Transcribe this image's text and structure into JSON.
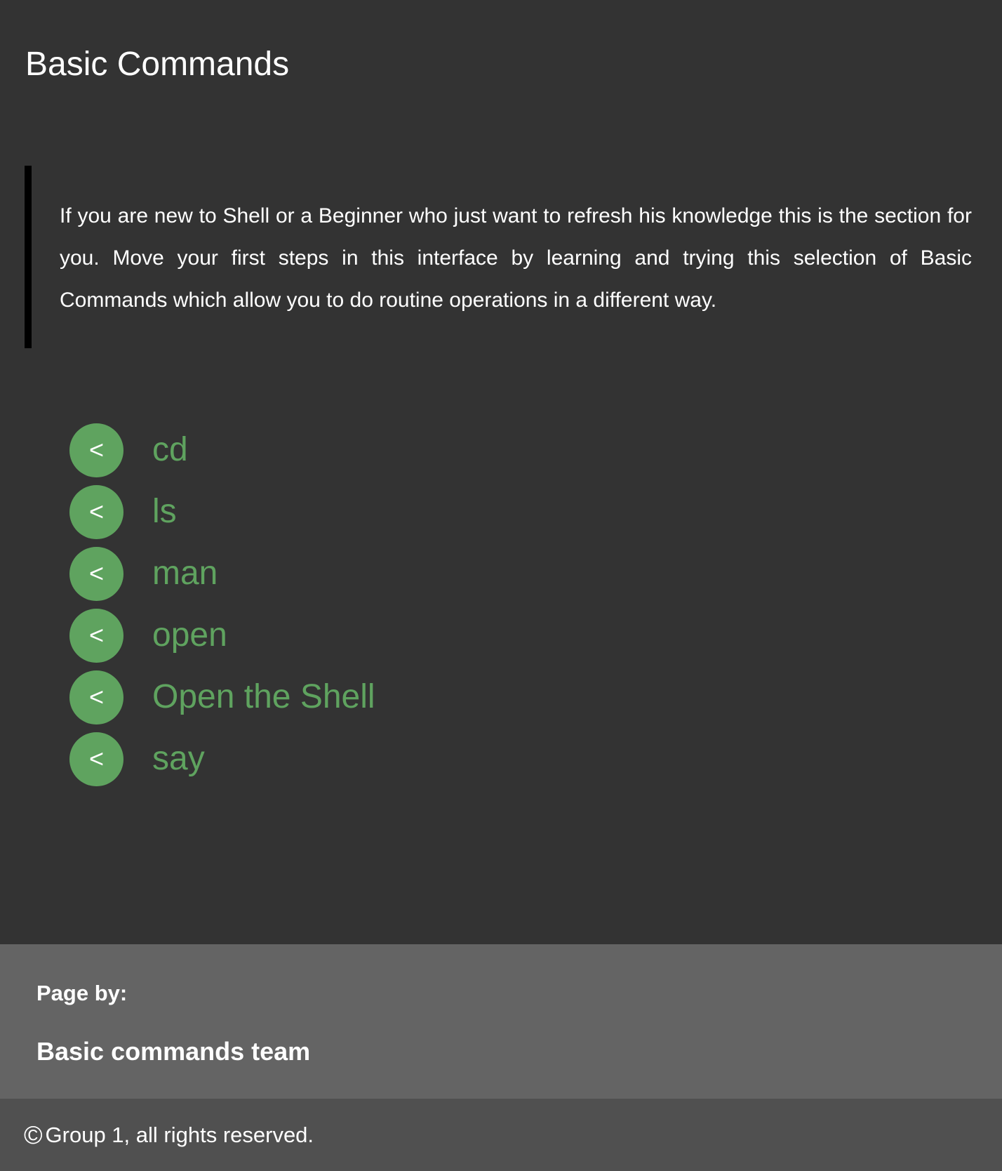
{
  "header": {
    "title": "Basic Commands"
  },
  "intro": {
    "text": "If you are new to Shell or a Beginner who just want to refresh his knowledge this is the section for you. Move your first steps in this interface by learning and trying this selection of Basic Commands which allow you to do routine operations in a different way."
  },
  "commands": {
    "items": [
      {
        "label": "cd",
        "icon": "<"
      },
      {
        "label": "ls",
        "icon": "<"
      },
      {
        "label": "man",
        "icon": "<"
      },
      {
        "label": "open",
        "icon": "<"
      },
      {
        "label": "Open the Shell",
        "icon": "<"
      },
      {
        "label": "say",
        "icon": "<"
      }
    ]
  },
  "footer": {
    "page_by_label": "Page by:",
    "team": "Basic commands team",
    "copyright_symbol": "©",
    "copyright": "Group 1, all rights reserved."
  },
  "colors": {
    "background": "#333333",
    "accent_green": "#5fa35f",
    "footer_top": "#646464",
    "footer_bottom": "#505050",
    "quote_bar": "#000000"
  }
}
